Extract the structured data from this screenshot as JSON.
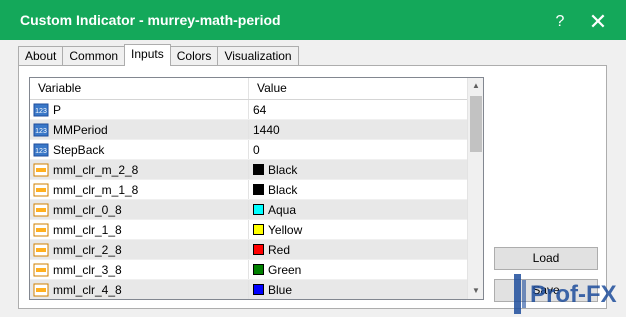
{
  "window": {
    "title": "Custom Indicator - murrey-math-period",
    "help_label": "?",
    "close_label": "✕"
  },
  "tabs": [
    {
      "label": "About"
    },
    {
      "label": "Common"
    },
    {
      "label": "Inputs"
    },
    {
      "label": "Colors"
    },
    {
      "label": "Visualization"
    }
  ],
  "grid": {
    "headers": {
      "variable": "Variable",
      "value": "Value"
    },
    "rows": [
      {
        "name": "P",
        "value": "64"
      },
      {
        "name": "MMPeriod",
        "value": "1440"
      },
      {
        "name": "StepBack",
        "value": "0"
      },
      {
        "name": "mml_clr_m_2_8",
        "value": "Black",
        "color": "#000000"
      },
      {
        "name": "mml_clr_m_1_8",
        "value": "Black",
        "color": "#000000"
      },
      {
        "name": "mml_clr_0_8",
        "value": "Aqua",
        "color": "#00ffff"
      },
      {
        "name": "mml_clr_1_8",
        "value": "Yellow",
        "color": "#ffff00"
      },
      {
        "name": "mml_clr_2_8",
        "value": "Red",
        "color": "#ff0000"
      },
      {
        "name": "mml_clr_3_8",
        "value": "Green",
        "color": "#008000"
      },
      {
        "name": "mml_clr_4_8",
        "value": "Blue",
        "color": "#0000ff"
      }
    ]
  },
  "buttons": {
    "load": "Load",
    "save": "Save"
  },
  "watermark": {
    "text": "Prof-FX"
  },
  "colors": {
    "titlebar": "#14a85a",
    "accent": "#1f4e9c"
  }
}
